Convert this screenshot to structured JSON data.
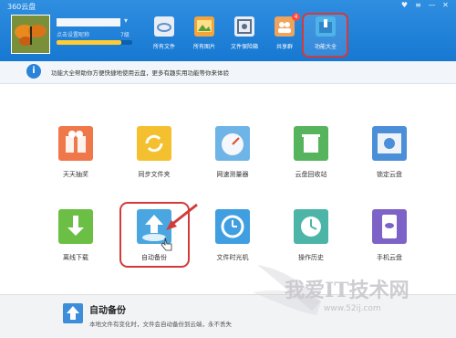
{
  "app": {
    "title": "360云盘"
  },
  "user": {
    "signature_prompt": "点击设置昵称",
    "level": "7级",
    "progress": 0.85
  },
  "toolbar": [
    {
      "label": "所有文件",
      "icon": "cloud-folder-icon",
      "color": "#e9eef4"
    },
    {
      "label": "所有图片",
      "icon": "picture-icon",
      "color": "#f3a43a"
    },
    {
      "label": "文件保险箱",
      "icon": "safe-icon",
      "color": "#e9eef4"
    },
    {
      "label": "共享群",
      "icon": "group-icon",
      "color": "#f0a35a",
      "badge": "4"
    },
    {
      "label": "功能大全",
      "icon": "toolbox-icon",
      "color": "#4db3e8",
      "active": true
    }
  ],
  "info": {
    "text": "功能大全帮助你方便快捷地使用云盘，更多有趣实用功能等你来体验"
  },
  "tiles": [
    {
      "name": "天天抽奖",
      "icon": "gift-icon",
      "color": "#f0774a"
    },
    {
      "name": "同步文件夹",
      "icon": "sync-folder-icon",
      "color": "#f5c02f"
    },
    {
      "name": "网速测量器",
      "icon": "speed-gauge-icon",
      "color": "#6fb4e6"
    },
    {
      "name": "云盘回收站",
      "icon": "recycle-bin-icon",
      "color": "#56b45c"
    },
    {
      "name": "锁定云盘",
      "icon": "lock-cloud-icon",
      "color": "#4a8fd8"
    },
    {
      "name": "离线下载",
      "icon": "download-icon",
      "color": "#6abf44"
    },
    {
      "name": "自动备份",
      "icon": "auto-backup-icon",
      "color": "#4aa6e0"
    },
    {
      "name": "文件时光机",
      "icon": "time-machine-icon",
      "color": "#3f9fe0"
    },
    {
      "name": "操作历史",
      "icon": "history-clock-icon",
      "color": "#4db5a8"
    },
    {
      "name": "手机云盘",
      "icon": "phone-cloud-icon",
      "color": "#7d63c8"
    }
  ],
  "detail": {
    "title": "自动备份",
    "description": "本地文件有变化时，文件会自动备份到云端，永不丢失"
  },
  "watermark": {
    "logo": "我爱IT技术网",
    "url": "www.52ij.com"
  }
}
